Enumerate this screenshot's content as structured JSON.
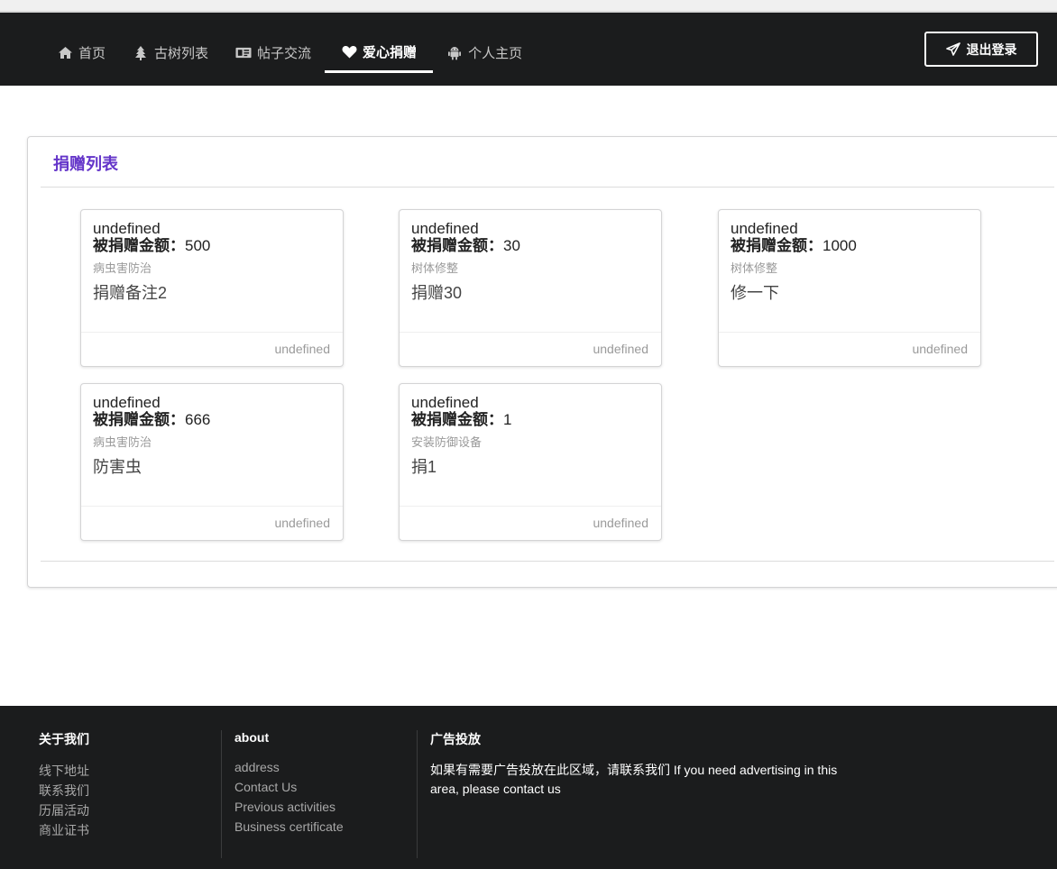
{
  "nav": {
    "items": [
      {
        "label": "首页",
        "icon": "home-icon",
        "active": false
      },
      {
        "label": "古树列表",
        "icon": "tree-icon",
        "active": false
      },
      {
        "label": "帖子交流",
        "icon": "id-card-icon",
        "active": false
      },
      {
        "label": "爱心捐赠",
        "icon": "heart-icon",
        "active": true
      },
      {
        "label": "个人主页",
        "icon": "android-icon",
        "active": false
      }
    ],
    "logout_label": "退出登录",
    "logout_icon": "paper-plane-icon"
  },
  "main": {
    "panel_title": "捐赠列表",
    "amount_label": "被捐赠金额：",
    "cards": [
      {
        "head": "undefined",
        "amount": "500",
        "category": "病虫害防治",
        "note": "捐赠备注2",
        "extra": "undefined"
      },
      {
        "head": "undefined",
        "amount": "30",
        "category": "树体修整",
        "note": "捐赠30",
        "extra": "undefined"
      },
      {
        "head": "undefined",
        "amount": "1000",
        "category": "树体修整",
        "note": "修一下",
        "extra": "undefined"
      },
      {
        "head": "undefined",
        "amount": "666",
        "category": "病虫害防治",
        "note": "防害虫",
        "extra": "undefined"
      },
      {
        "head": "undefined",
        "amount": "1",
        "category": "安装防御设备",
        "note": "捐1",
        "extra": "undefined"
      }
    ]
  },
  "footer": {
    "col1": {
      "title": "关于我们",
      "links": [
        "线下地址",
        "联系我们",
        "历届活动",
        "商业证书"
      ]
    },
    "col2": {
      "title": "about",
      "links": [
        "address",
        "Contact Us",
        "Previous activities",
        "Business certificate"
      ]
    },
    "col3": {
      "title": "广告投放",
      "text": "如果有需要广告投放在此区域，请联系我们 If you need advertising in this area, please contact us"
    }
  },
  "colors": {
    "navbar": "#1b1c1d",
    "accent_title": "#6435c9",
    "footer": "#1b1c1d"
  }
}
